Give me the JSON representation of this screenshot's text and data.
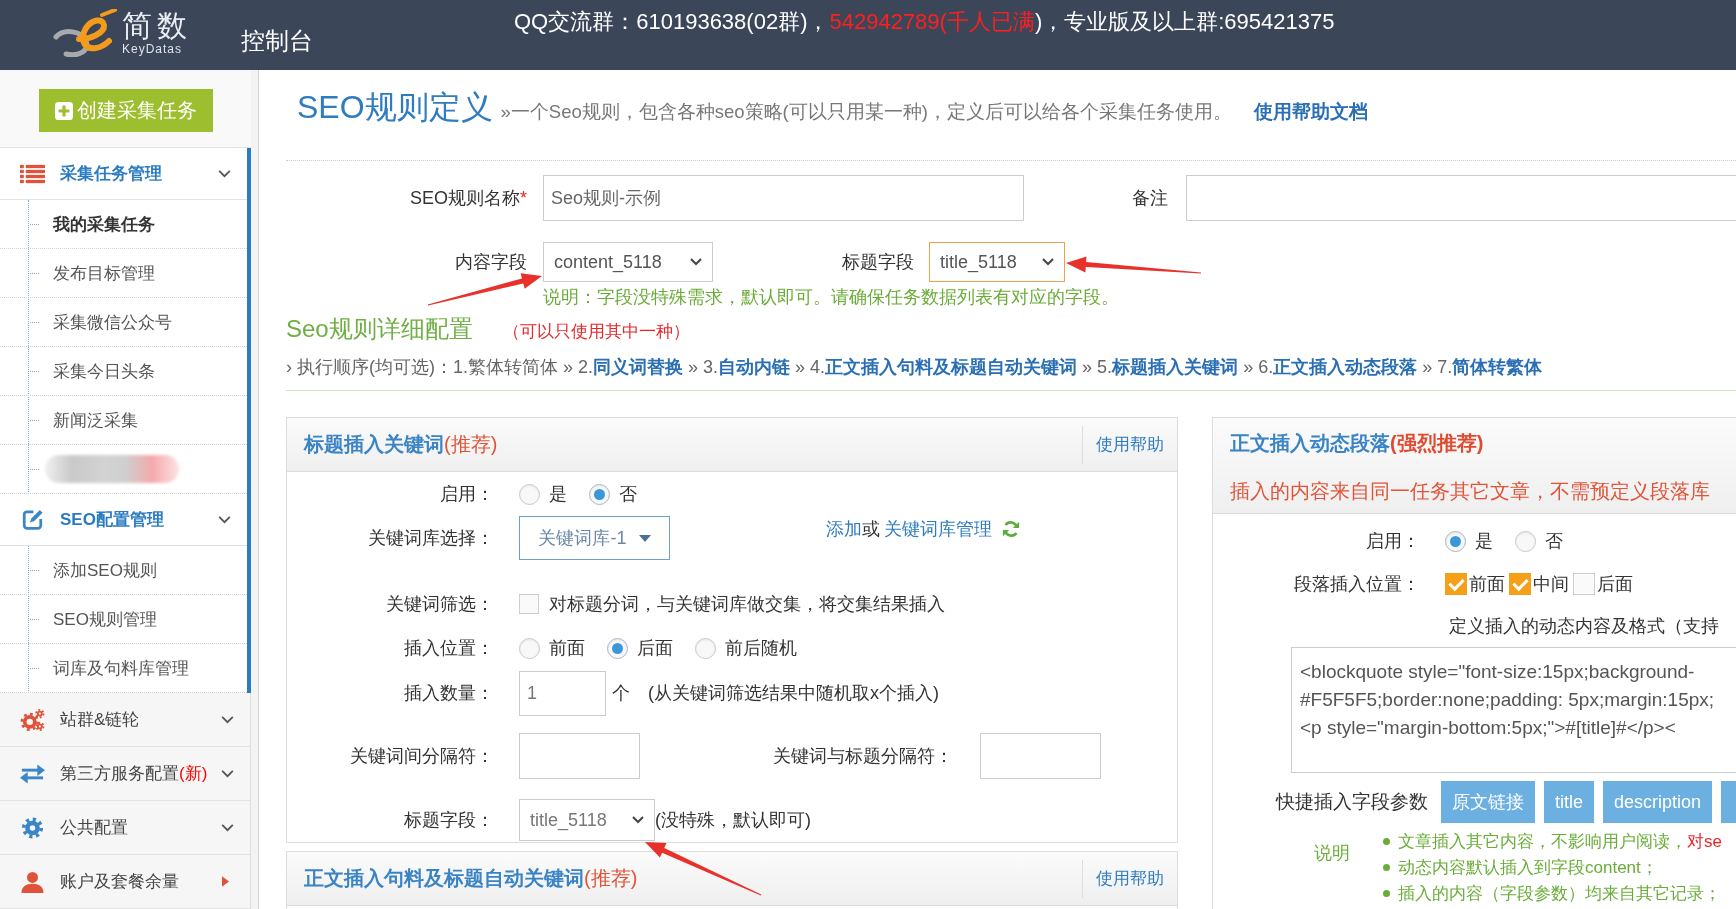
{
  "header": {
    "brand": "简数",
    "brand_sub": "KeyDatas",
    "console_title": "控制台",
    "notice": [
      {
        "text": "QQ交流群：610193638(02群)，",
        "highlight": false
      },
      {
        "text": "542942789(千人已满",
        "highlight": true
      },
      {
        "text": ")，专业版及以上群:695421375",
        "highlight": false
      }
    ]
  },
  "sidebar": {
    "create_button": "创建采集任务",
    "groups": [
      {
        "kind": "group",
        "label": "采集任务管理",
        "expanded": true,
        "items": [
          {
            "kind": "text",
            "label": "我的采集任务",
            "selected": true
          },
          {
            "kind": "text",
            "label": "发布目标管理",
            "selected": false
          },
          {
            "kind": "text",
            "label": "采集微信公众号",
            "selected": false
          },
          {
            "kind": "text",
            "label": "采集今日头条",
            "selected": false
          },
          {
            "kind": "text",
            "label": "新闻泛采集",
            "selected": false
          },
          {
            "kind": "redacted",
            "selected": false
          }
        ]
      },
      {
        "kind": "group",
        "label": "SEO配置管理",
        "expanded": true,
        "items": [
          {
            "kind": "text",
            "label": "添加SEO规则",
            "selected": false
          },
          {
            "kind": "text",
            "label": "SEO规则管理",
            "selected": false
          },
          {
            "kind": "text",
            "label": "词库及句料库管理",
            "selected": false
          }
        ]
      },
      {
        "kind": "group",
        "label": "站群&链轮",
        "expanded": false
      },
      {
        "kind": "group",
        "label": "第三方服务配置",
        "badge": "(新)",
        "expanded": false
      },
      {
        "kind": "group",
        "label": "公共配置",
        "expanded": false
      },
      {
        "kind": "link",
        "label": "账户及套餐余量",
        "expanded": false
      }
    ]
  },
  "page": {
    "title": "SEO规则定义",
    "subtitle": "»一个Seo规则，包含各种seo策略(可以只用某一种)，定义后可以给各个采集任务使用。",
    "help_link": "使用帮助文档"
  },
  "form": {
    "rule_name": {
      "label": "SEO规则名称",
      "required_mark": "*",
      "value": "Seo规则-示例"
    },
    "remark": {
      "label": "备注"
    },
    "content_field": {
      "label": "内容字段",
      "value": "content_5118",
      "focused": false,
      "annotated": true
    },
    "title_field": {
      "label": "标题字段",
      "value": "title_5118",
      "focused": true,
      "annotated": true
    },
    "hint": "说明：字段没特殊需求，默认即可。请确保任务数据列表有对应的字段。"
  },
  "detail": {
    "title": "Seo规则详细配置",
    "note": "（可以只使用其中一种）",
    "order_marker": "›",
    "order_label": "执行顺序(均可选)：",
    "separator": "»",
    "steps": [
      {
        "number": "1.",
        "label": "繁体转简体",
        "link": false
      },
      {
        "number": "2.",
        "label": "同义词替换",
        "link": true
      },
      {
        "number": "3.",
        "label": "自动内链",
        "link": true
      },
      {
        "number": "4.",
        "label": "正文插入句料及标题自动关键词",
        "link": true
      },
      {
        "number": "5.",
        "label": "标题插入关键词",
        "link": true
      },
      {
        "number": "6.",
        "label": "正文插入动态段落",
        "link": true
      },
      {
        "number": "7.",
        "label": "简体转繁体",
        "link": true
      }
    ]
  },
  "panels": {
    "left": [
      {
        "title": "标题插入关键词",
        "tag": "(推荐)",
        "help": "使用帮助",
        "rows": [
          {
            "kind": "radio",
            "label": "启用：",
            "options": [
              {
                "label": "是",
                "selected": false
              },
              {
                "label": "否",
                "selected": true
              }
            ]
          },
          {
            "kind": "dropdown",
            "label": "关键词库选择：",
            "value": "关键词库-1",
            "actions": [
              {
                "kind": "link",
                "text": "添加"
              },
              {
                "kind": "text",
                "text": "或"
              },
              {
                "kind": "link",
                "text": "关键词库管理"
              }
            ]
          },
          {
            "kind": "checkbox",
            "label": "关键词筛选：",
            "text": "对标题分词，与关键词库做交集，将交集结果插入",
            "checked": false
          },
          {
            "kind": "radio",
            "label": "插入位置：",
            "options": [
              {
                "label": "前面",
                "selected": false
              },
              {
                "label": "后面",
                "selected": true
              },
              {
                "label": "前后随机",
                "selected": false
              }
            ]
          },
          {
            "kind": "number",
            "label": "插入数量：",
            "value": "1",
            "unit": "个",
            "hint": "(从关键词筛选结果中随机取x个插入)"
          },
          {
            "kind": "pair",
            "label": "关键词间分隔符：",
            "second_label": "关键词与标题分隔符："
          },
          {
            "kind": "select",
            "label": "标题字段：",
            "value": "title_5118",
            "hint": "(没特殊，默认即可)",
            "annotated": true
          }
        ]
      },
      {
        "title": "正文插入句料及标题自动关键词",
        "tag": "(推荐)",
        "help": "使用帮助"
      }
    ],
    "right": [
      {
        "title": "正文插入动态段落",
        "tag": "(强烈推荐)",
        "subtitle": "插入的内容来自同一任务其它文章，不需预定义段落库",
        "rows": [
          {
            "kind": "radio",
            "label": "启用：",
            "options": [
              {
                "label": "是",
                "selected": true
              },
              {
                "label": "否",
                "selected": false
              }
            ]
          },
          {
            "kind": "checkboxes",
            "label": "段落插入位置：",
            "options": [
              {
                "label": "前面",
                "checked": true
              },
              {
                "label": "中间",
                "checked": true
              },
              {
                "label": "后面",
                "checked": false
              }
            ]
          },
          {
            "kind": "caption",
            "text": "定义插入的动态内容及格式（支持"
          },
          {
            "kind": "code",
            "lines": [
              "<blockquote style=\"font-size:15px;background-",
              "#F5F5F5;border:none;padding: 5px;margin:15px;",
              "<p style=\"margin-bottom:5px;\">#[title]#</p><"
            ]
          },
          {
            "kind": "buttons",
            "label": "快捷插入字段参数",
            "buttons": [
              {
                "kind": "button",
                "label": "原文链接"
              },
              {
                "kind": "button",
                "label": "title"
              },
              {
                "kind": "button",
                "label": "description"
              },
              {
                "kind": "clipped"
              }
            ]
          },
          {
            "kind": "notes",
            "label": "说明",
            "notes": [
              {
                "text": "文章插入其它内容，不影响用户阅读，",
                "highlight": "对se"
              },
              {
                "text": "动态内容默认插入到字段content；"
              },
              {
                "text": "插入的内容（字段参数）均来自其它记录；"
              }
            ]
          }
        ]
      }
    ]
  }
}
